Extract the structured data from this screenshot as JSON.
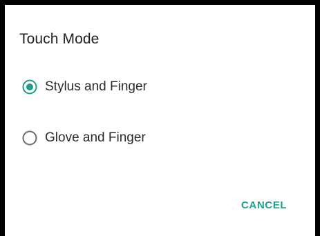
{
  "dialog": {
    "title": "Touch Mode",
    "options": [
      {
        "label": "Stylus and Finger",
        "selected": true
      },
      {
        "label": "Glove and Finger",
        "selected": false
      }
    ],
    "cancel_label": "CANCEL",
    "accent_color": "#1e9e8c",
    "radio_unselected_color": "#6b6b6b",
    "backdrop_color": "#000000"
  }
}
